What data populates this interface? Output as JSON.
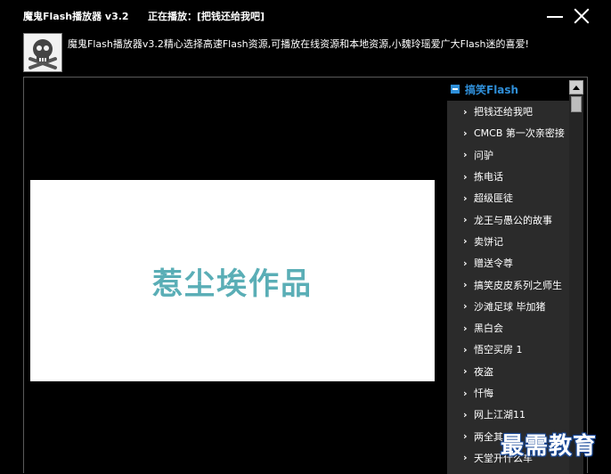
{
  "window": {
    "app_title": "魔鬼Flash播放器 v3.2",
    "now_playing": "正在播放：[把钱还给我吧]"
  },
  "header": {
    "logo_icon": "skull-crossbones-icon",
    "description": "魔鬼Flash播放器v3.2精心选择高速Flash资源,可播放在线资源和本地资源,小魏玲瑶爱广大Flash迷的喜爱!"
  },
  "stage": {
    "flash_text": "惹尘埃作品"
  },
  "playlist": {
    "category": "搞笑Flash",
    "items": [
      {
        "label": "把钱还给我吧"
      },
      {
        "label": "CMCB 第一次亲密接"
      },
      {
        "label": "问驴"
      },
      {
        "label": "拣电话"
      },
      {
        "label": "超级匪徒"
      },
      {
        "label": "龙王与愚公的故事"
      },
      {
        "label": "卖饼记"
      },
      {
        "label": "赠送令尊"
      },
      {
        "label": "搞笑皮皮系列之师生"
      },
      {
        "label": "沙滩足球 毕加猪"
      },
      {
        "label": "黑白会"
      },
      {
        "label": "悟空买房 1"
      },
      {
        "label": "夜盗"
      },
      {
        "label": "忏悔"
      },
      {
        "label": "网上江湖11"
      },
      {
        "label": "两全其"
      },
      {
        "label": "天堂开什么车"
      }
    ]
  },
  "watermark": "最需教育"
}
